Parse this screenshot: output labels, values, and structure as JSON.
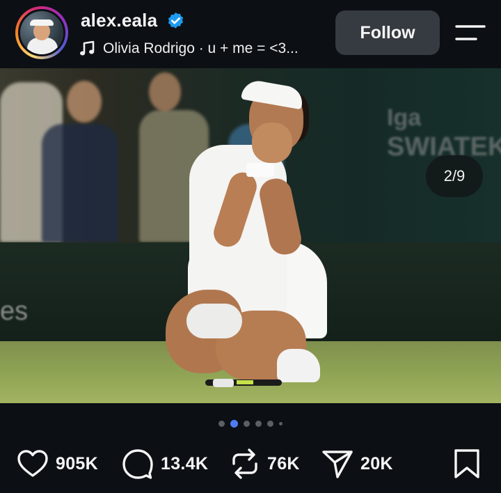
{
  "header": {
    "username": "alex.eala",
    "music": "Olivia Rodrigo · u + me = <3...",
    "follow_label": "Follow"
  },
  "post": {
    "image_counter": "2/9",
    "background_text": {
      "board_line1": "Iga",
      "board_line2": "SWIATEK",
      "wall_text": "es"
    },
    "carousel": {
      "total_dots": 6,
      "active_index": 1
    }
  },
  "actions": {
    "likes": "905K",
    "comments": "13.4K",
    "reposts": "76K",
    "shares": "20K"
  },
  "colors": {
    "background": "#0c1014",
    "verified": "#1d9bf0",
    "active_dot": "#4f7cf5",
    "follow_button": "#363a41"
  },
  "icons": [
    "verified-badge-icon",
    "music-note-icon",
    "menu-icon",
    "sound-icon",
    "heart-icon",
    "comment-icon",
    "repost-icon",
    "share-icon",
    "bookmark-icon"
  ]
}
